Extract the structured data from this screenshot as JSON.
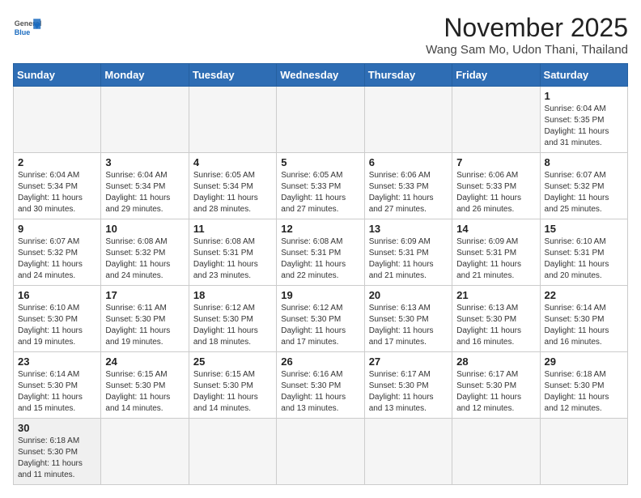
{
  "header": {
    "logo_general": "General",
    "logo_blue": "Blue",
    "month_year": "November 2025",
    "location": "Wang Sam Mo, Udon Thani, Thailand"
  },
  "weekdays": [
    "Sunday",
    "Monday",
    "Tuesday",
    "Wednesday",
    "Thursday",
    "Friday",
    "Saturday"
  ],
  "weeks": [
    [
      {
        "day": "",
        "info": ""
      },
      {
        "day": "",
        "info": ""
      },
      {
        "day": "",
        "info": ""
      },
      {
        "day": "",
        "info": ""
      },
      {
        "day": "",
        "info": ""
      },
      {
        "day": "",
        "info": ""
      },
      {
        "day": "1",
        "info": "Sunrise: 6:04 AM\nSunset: 5:35 PM\nDaylight: 11 hours\nand 31 minutes."
      }
    ],
    [
      {
        "day": "2",
        "info": "Sunrise: 6:04 AM\nSunset: 5:34 PM\nDaylight: 11 hours\nand 30 minutes."
      },
      {
        "day": "3",
        "info": "Sunrise: 6:04 AM\nSunset: 5:34 PM\nDaylight: 11 hours\nand 29 minutes."
      },
      {
        "day": "4",
        "info": "Sunrise: 6:05 AM\nSunset: 5:34 PM\nDaylight: 11 hours\nand 28 minutes."
      },
      {
        "day": "5",
        "info": "Sunrise: 6:05 AM\nSunset: 5:33 PM\nDaylight: 11 hours\nand 27 minutes."
      },
      {
        "day": "6",
        "info": "Sunrise: 6:06 AM\nSunset: 5:33 PM\nDaylight: 11 hours\nand 27 minutes."
      },
      {
        "day": "7",
        "info": "Sunrise: 6:06 AM\nSunset: 5:33 PM\nDaylight: 11 hours\nand 26 minutes."
      },
      {
        "day": "8",
        "info": "Sunrise: 6:07 AM\nSunset: 5:32 PM\nDaylight: 11 hours\nand 25 minutes."
      }
    ],
    [
      {
        "day": "9",
        "info": "Sunrise: 6:07 AM\nSunset: 5:32 PM\nDaylight: 11 hours\nand 24 minutes."
      },
      {
        "day": "10",
        "info": "Sunrise: 6:08 AM\nSunset: 5:32 PM\nDaylight: 11 hours\nand 24 minutes."
      },
      {
        "day": "11",
        "info": "Sunrise: 6:08 AM\nSunset: 5:31 PM\nDaylight: 11 hours\nand 23 minutes."
      },
      {
        "day": "12",
        "info": "Sunrise: 6:08 AM\nSunset: 5:31 PM\nDaylight: 11 hours\nand 22 minutes."
      },
      {
        "day": "13",
        "info": "Sunrise: 6:09 AM\nSunset: 5:31 PM\nDaylight: 11 hours\nand 21 minutes."
      },
      {
        "day": "14",
        "info": "Sunrise: 6:09 AM\nSunset: 5:31 PM\nDaylight: 11 hours\nand 21 minutes."
      },
      {
        "day": "15",
        "info": "Sunrise: 6:10 AM\nSunset: 5:31 PM\nDaylight: 11 hours\nand 20 minutes."
      }
    ],
    [
      {
        "day": "16",
        "info": "Sunrise: 6:10 AM\nSunset: 5:30 PM\nDaylight: 11 hours\nand 19 minutes."
      },
      {
        "day": "17",
        "info": "Sunrise: 6:11 AM\nSunset: 5:30 PM\nDaylight: 11 hours\nand 19 minutes."
      },
      {
        "day": "18",
        "info": "Sunrise: 6:12 AM\nSunset: 5:30 PM\nDaylight: 11 hours\nand 18 minutes."
      },
      {
        "day": "19",
        "info": "Sunrise: 6:12 AM\nSunset: 5:30 PM\nDaylight: 11 hours\nand 17 minutes."
      },
      {
        "day": "20",
        "info": "Sunrise: 6:13 AM\nSunset: 5:30 PM\nDaylight: 11 hours\nand 17 minutes."
      },
      {
        "day": "21",
        "info": "Sunrise: 6:13 AM\nSunset: 5:30 PM\nDaylight: 11 hours\nand 16 minutes."
      },
      {
        "day": "22",
        "info": "Sunrise: 6:14 AM\nSunset: 5:30 PM\nDaylight: 11 hours\nand 16 minutes."
      }
    ],
    [
      {
        "day": "23",
        "info": "Sunrise: 6:14 AM\nSunset: 5:30 PM\nDaylight: 11 hours\nand 15 minutes."
      },
      {
        "day": "24",
        "info": "Sunrise: 6:15 AM\nSunset: 5:30 PM\nDaylight: 11 hours\nand 14 minutes."
      },
      {
        "day": "25",
        "info": "Sunrise: 6:15 AM\nSunset: 5:30 PM\nDaylight: 11 hours\nand 14 minutes."
      },
      {
        "day": "26",
        "info": "Sunrise: 6:16 AM\nSunset: 5:30 PM\nDaylight: 11 hours\nand 13 minutes."
      },
      {
        "day": "27",
        "info": "Sunrise: 6:17 AM\nSunset: 5:30 PM\nDaylight: 11 hours\nand 13 minutes."
      },
      {
        "day": "28",
        "info": "Sunrise: 6:17 AM\nSunset: 5:30 PM\nDaylight: 11 hours\nand 12 minutes."
      },
      {
        "day": "29",
        "info": "Sunrise: 6:18 AM\nSunset: 5:30 PM\nDaylight: 11 hours\nand 12 minutes."
      }
    ],
    [
      {
        "day": "30",
        "info": "Sunrise: 6:18 AM\nSunset: 5:30 PM\nDaylight: 11 hours\nand 11 minutes."
      },
      {
        "day": "",
        "info": ""
      },
      {
        "day": "",
        "info": ""
      },
      {
        "day": "",
        "info": ""
      },
      {
        "day": "",
        "info": ""
      },
      {
        "day": "",
        "info": ""
      },
      {
        "day": "",
        "info": ""
      }
    ]
  ]
}
